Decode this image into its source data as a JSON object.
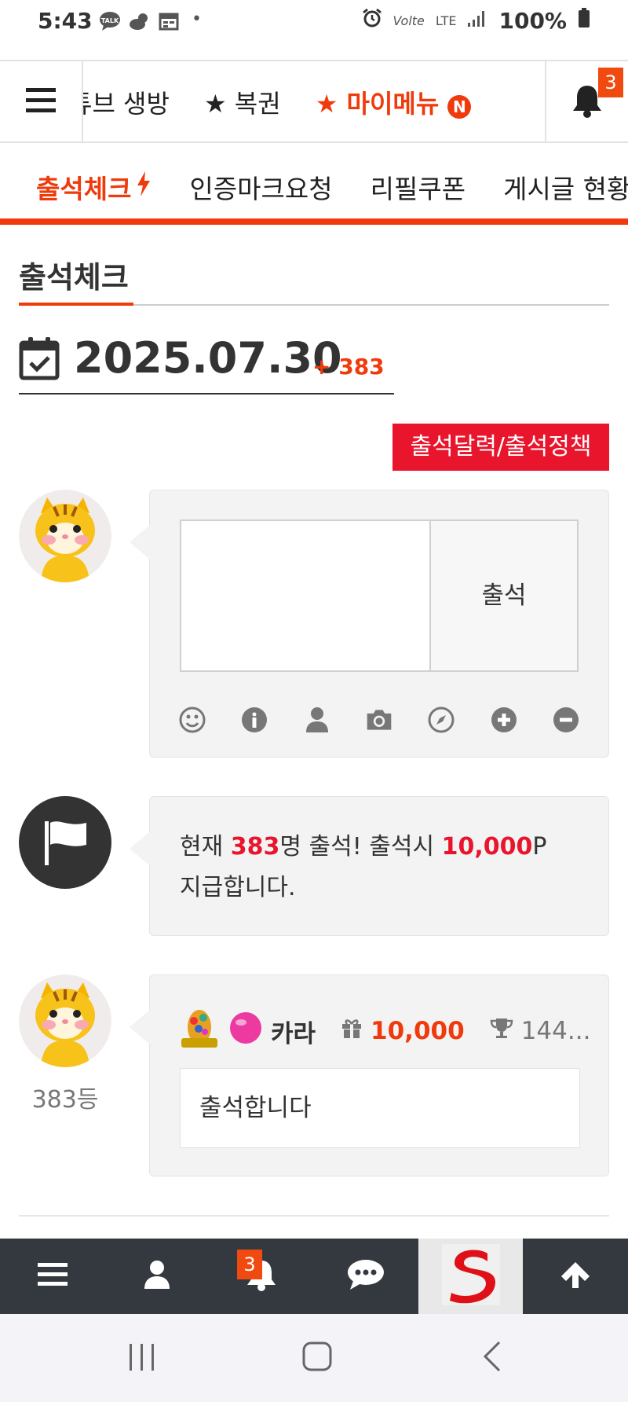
{
  "status_bar": {
    "time": "5:43",
    "left_icons": [
      "talk-icon",
      "weather-icon",
      "calendar-icon",
      "dot-icon"
    ],
    "right_icons": [
      "alarm-icon",
      "volte-icon",
      "lte-icon",
      "signal-icon",
      "battery-icon"
    ],
    "volte": "Volte",
    "lte": "LTE",
    "battery": "100%"
  },
  "top_nav": {
    "items": [
      "튜브 생방",
      "★ 복권"
    ],
    "mymenu_label": "★ 마이메뉴",
    "mymenu_badge": "N",
    "notification_count": "3"
  },
  "sub_nav": {
    "active": "출석체크",
    "items": [
      "인증마크요청",
      "리필쿠폰",
      "게시글 현황"
    ]
  },
  "page": {
    "title": "출석체크",
    "date": "2025.07.30",
    "date_count": "+ 383",
    "policy_button": "출석달력/출석정책"
  },
  "attendance_form": {
    "text_value": "",
    "submit_label": "출석",
    "toolbar": [
      "smile-icon",
      "info-icon",
      "user-icon",
      "camera-icon",
      "compass-icon",
      "plus-circle-icon",
      "minus-circle-icon"
    ]
  },
  "notice": {
    "prefix": "현재 ",
    "count": "383",
    "middle": "명 출석! 출석시 ",
    "points": "10,000",
    "suffix": "P 지급합니다."
  },
  "comment": {
    "name": "카라",
    "points": "10,000",
    "trophy": "144...",
    "body": "출석합니다",
    "rank": "383등"
  },
  "bottom_bar": {
    "notification_count": "3",
    "icons": [
      "menu-icon",
      "user-icon",
      "bell-icon",
      "chat-icon",
      "site-logo",
      "arrow-up-icon"
    ]
  },
  "colors": {
    "accent": "#f03a0c",
    "red": "#e8152d",
    "bottom_bar": "#34393f"
  }
}
